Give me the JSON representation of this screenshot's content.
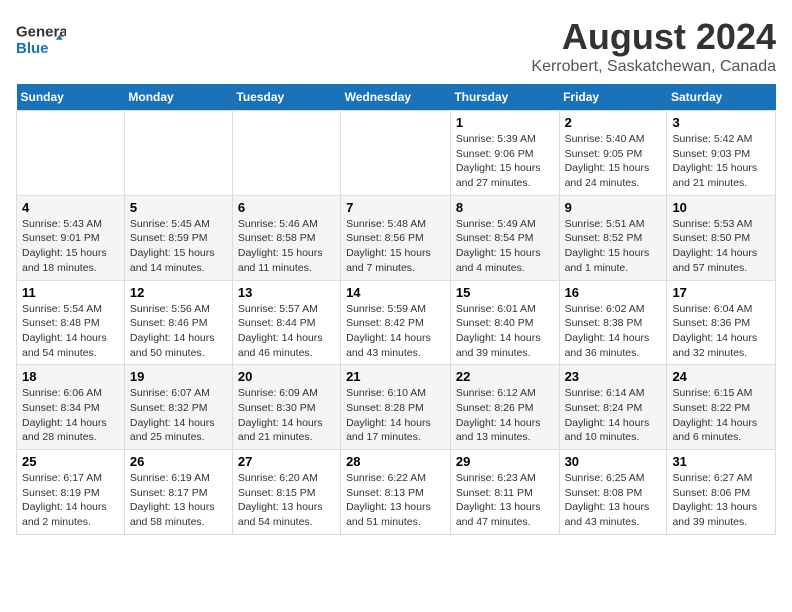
{
  "header": {
    "logo_general": "General",
    "logo_blue": "Blue",
    "title": "August 2024",
    "subtitle": "Kerrobert, Saskatchewan, Canada"
  },
  "calendar": {
    "headers": [
      "Sunday",
      "Monday",
      "Tuesday",
      "Wednesday",
      "Thursday",
      "Friday",
      "Saturday"
    ],
    "weeks": [
      [
        {
          "day": "",
          "info": ""
        },
        {
          "day": "",
          "info": ""
        },
        {
          "day": "",
          "info": ""
        },
        {
          "day": "",
          "info": ""
        },
        {
          "day": "1",
          "info": "Sunrise: 5:39 AM\nSunset: 9:06 PM\nDaylight: 15 hours\nand 27 minutes."
        },
        {
          "day": "2",
          "info": "Sunrise: 5:40 AM\nSunset: 9:05 PM\nDaylight: 15 hours\nand 24 minutes."
        },
        {
          "day": "3",
          "info": "Sunrise: 5:42 AM\nSunset: 9:03 PM\nDaylight: 15 hours\nand 21 minutes."
        }
      ],
      [
        {
          "day": "4",
          "info": "Sunrise: 5:43 AM\nSunset: 9:01 PM\nDaylight: 15 hours\nand 18 minutes."
        },
        {
          "day": "5",
          "info": "Sunrise: 5:45 AM\nSunset: 8:59 PM\nDaylight: 15 hours\nand 14 minutes."
        },
        {
          "day": "6",
          "info": "Sunrise: 5:46 AM\nSunset: 8:58 PM\nDaylight: 15 hours\nand 11 minutes."
        },
        {
          "day": "7",
          "info": "Sunrise: 5:48 AM\nSunset: 8:56 PM\nDaylight: 15 hours\nand 7 minutes."
        },
        {
          "day": "8",
          "info": "Sunrise: 5:49 AM\nSunset: 8:54 PM\nDaylight: 15 hours\nand 4 minutes."
        },
        {
          "day": "9",
          "info": "Sunrise: 5:51 AM\nSunset: 8:52 PM\nDaylight: 15 hours\nand 1 minute."
        },
        {
          "day": "10",
          "info": "Sunrise: 5:53 AM\nSunset: 8:50 PM\nDaylight: 14 hours\nand 57 minutes."
        }
      ],
      [
        {
          "day": "11",
          "info": "Sunrise: 5:54 AM\nSunset: 8:48 PM\nDaylight: 14 hours\nand 54 minutes."
        },
        {
          "day": "12",
          "info": "Sunrise: 5:56 AM\nSunset: 8:46 PM\nDaylight: 14 hours\nand 50 minutes."
        },
        {
          "day": "13",
          "info": "Sunrise: 5:57 AM\nSunset: 8:44 PM\nDaylight: 14 hours\nand 46 minutes."
        },
        {
          "day": "14",
          "info": "Sunrise: 5:59 AM\nSunset: 8:42 PM\nDaylight: 14 hours\nand 43 minutes."
        },
        {
          "day": "15",
          "info": "Sunrise: 6:01 AM\nSunset: 8:40 PM\nDaylight: 14 hours\nand 39 minutes."
        },
        {
          "day": "16",
          "info": "Sunrise: 6:02 AM\nSunset: 8:38 PM\nDaylight: 14 hours\nand 36 minutes."
        },
        {
          "day": "17",
          "info": "Sunrise: 6:04 AM\nSunset: 8:36 PM\nDaylight: 14 hours\nand 32 minutes."
        }
      ],
      [
        {
          "day": "18",
          "info": "Sunrise: 6:06 AM\nSunset: 8:34 PM\nDaylight: 14 hours\nand 28 minutes."
        },
        {
          "day": "19",
          "info": "Sunrise: 6:07 AM\nSunset: 8:32 PM\nDaylight: 14 hours\nand 25 minutes."
        },
        {
          "day": "20",
          "info": "Sunrise: 6:09 AM\nSunset: 8:30 PM\nDaylight: 14 hours\nand 21 minutes."
        },
        {
          "day": "21",
          "info": "Sunrise: 6:10 AM\nSunset: 8:28 PM\nDaylight: 14 hours\nand 17 minutes."
        },
        {
          "day": "22",
          "info": "Sunrise: 6:12 AM\nSunset: 8:26 PM\nDaylight: 14 hours\nand 13 minutes."
        },
        {
          "day": "23",
          "info": "Sunrise: 6:14 AM\nSunset: 8:24 PM\nDaylight: 14 hours\nand 10 minutes."
        },
        {
          "day": "24",
          "info": "Sunrise: 6:15 AM\nSunset: 8:22 PM\nDaylight: 14 hours\nand 6 minutes."
        }
      ],
      [
        {
          "day": "25",
          "info": "Sunrise: 6:17 AM\nSunset: 8:19 PM\nDaylight: 14 hours\nand 2 minutes."
        },
        {
          "day": "26",
          "info": "Sunrise: 6:19 AM\nSunset: 8:17 PM\nDaylight: 13 hours\nand 58 minutes."
        },
        {
          "day": "27",
          "info": "Sunrise: 6:20 AM\nSunset: 8:15 PM\nDaylight: 13 hours\nand 54 minutes."
        },
        {
          "day": "28",
          "info": "Sunrise: 6:22 AM\nSunset: 8:13 PM\nDaylight: 13 hours\nand 51 minutes."
        },
        {
          "day": "29",
          "info": "Sunrise: 6:23 AM\nSunset: 8:11 PM\nDaylight: 13 hours\nand 47 minutes."
        },
        {
          "day": "30",
          "info": "Sunrise: 6:25 AM\nSunset: 8:08 PM\nDaylight: 13 hours\nand 43 minutes."
        },
        {
          "day": "31",
          "info": "Sunrise: 6:27 AM\nSunset: 8:06 PM\nDaylight: 13 hours\nand 39 minutes."
        }
      ]
    ]
  }
}
